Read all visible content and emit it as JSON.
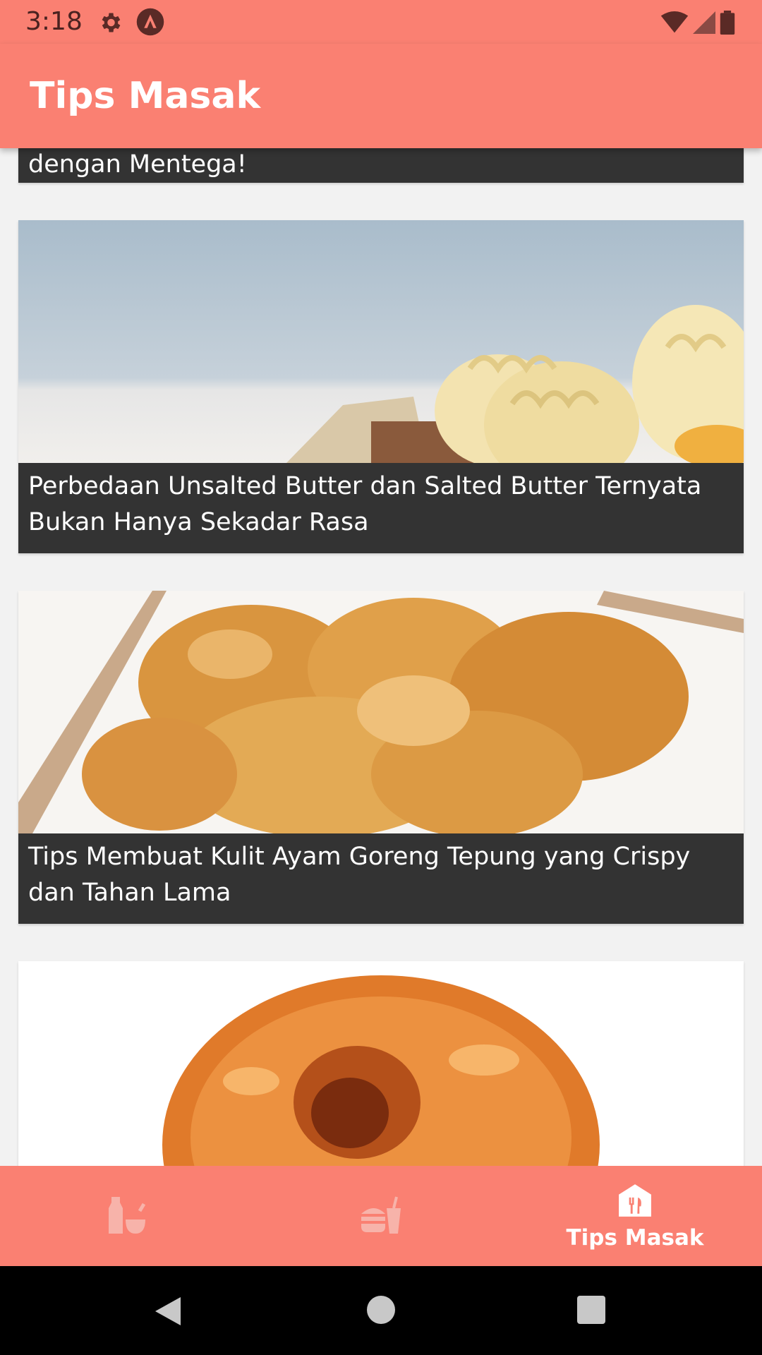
{
  "status_bar": {
    "time": "3:18"
  },
  "app_bar": {
    "title": "Tips Masak"
  },
  "articles": [
    {
      "title": "dengan Mentega!"
    },
    {
      "title": "Perbedaan Unsalted Butter dan Salted Butter Ternyata Bukan Hanya Sekadar Rasa"
    },
    {
      "title": "Tips Membuat Kulit Ayam Goreng Tepung yang Crispy dan Tahan Lama"
    },
    {
      "title": ""
    }
  ],
  "bottom_nav": {
    "items": [
      {
        "icon": "ingredients-icon",
        "label": ""
      },
      {
        "icon": "fast-food-icon",
        "label": ""
      },
      {
        "icon": "tips-masak-icon",
        "label": "Tips Masak",
        "selected": true
      }
    ]
  },
  "colors": {
    "primary": "#fa8072",
    "caption_bg": "#333333"
  }
}
